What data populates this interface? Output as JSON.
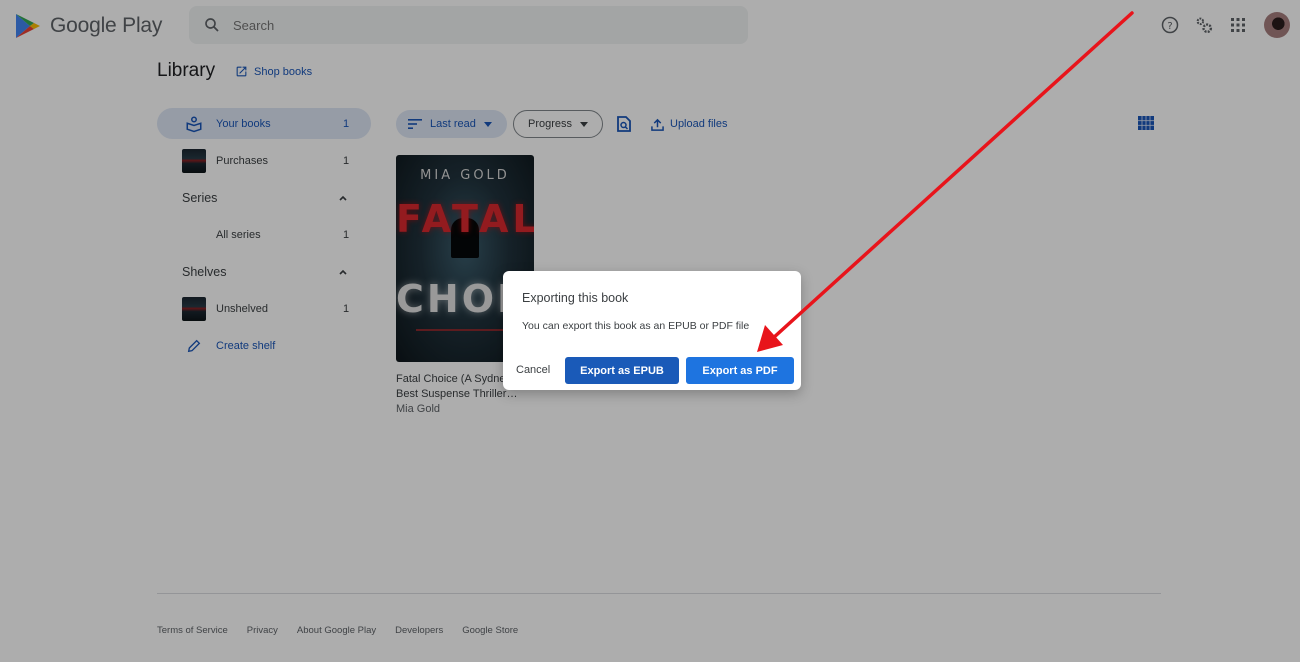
{
  "header": {
    "brand": "Google Play",
    "search_placeholder": "Search",
    "icons": [
      "help-icon",
      "settings-icon",
      "apps-icon",
      "avatar"
    ]
  },
  "library": {
    "title": "Library",
    "shop_link": "Shop books"
  },
  "sidebar": {
    "items": [
      {
        "label": "Your books",
        "count": "1",
        "icon": "books-icon",
        "active": true
      },
      {
        "label": "Purchases",
        "count": "1",
        "icon": "book-thumbnail"
      }
    ],
    "series": {
      "label": "Series",
      "items": [
        {
          "label": "All series",
          "count": "1"
        }
      ]
    },
    "shelves": {
      "label": "Shelves",
      "items": [
        {
          "label": "Unshelved",
          "count": "1",
          "icon": "book-thumbnail"
        }
      ],
      "create_label": "Create shelf"
    }
  },
  "toolbar": {
    "sort_label": "Last read",
    "filter_label": "Progress",
    "upload_label": "Upload files"
  },
  "books": [
    {
      "title": "Fatal Choice (A Sydney Best Suspense Thriller…",
      "title_line1": "Fatal Choice (A Sydne",
      "title_line2": "Best Suspense Thriller…",
      "author": "Mia Gold",
      "cover": {
        "author": "MIA GOLD",
        "title_top": "FATAL",
        "title_bottom": "CHOICE"
      }
    }
  ],
  "dialog": {
    "title": "Exporting this book",
    "body": "You can export this book as an EPUB or PDF file",
    "cancel_label": "Cancel",
    "epub_label": "Export as EPUB",
    "pdf_label": "Export as PDF"
  },
  "footer": {
    "links": [
      "Terms of Service",
      "Privacy",
      "About Google Play",
      "Developers",
      "Google Store"
    ]
  },
  "annotation": {
    "color": "#e8141b",
    "points_to": "Export as PDF"
  }
}
